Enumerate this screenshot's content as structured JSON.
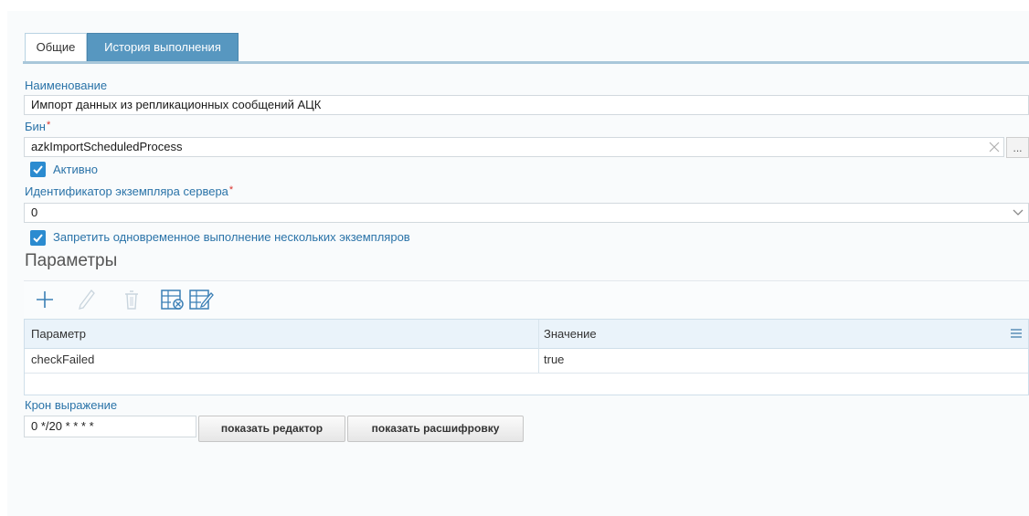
{
  "tabs": [
    {
      "label": "Общие",
      "active": true
    },
    {
      "label": "История выполнения",
      "active": false
    }
  ],
  "form": {
    "name_label": "Наименование",
    "name_value": "Импорт данных из репликационных сообщений АЦК",
    "bean_label": "Бин",
    "bean_value": "azkImportScheduledProcess",
    "bean_clear_icon": "close-icon",
    "bean_lookup_label": "...",
    "active_label": "Активно",
    "active_checked": true,
    "server_id_label": "Идентификатор экземпляра сервера",
    "server_id_value": "0",
    "concurrent_label": "Запретить одновременное выполнение нескольких экземпляров",
    "concurrent_checked": true,
    "required_mark": "*"
  },
  "params": {
    "title": "Параметры",
    "toolbar_icons": [
      "plus-icon",
      "pencil-icon",
      "trash-icon",
      "table-remove-icon",
      "table-edit-icon"
    ],
    "columns": [
      "Параметр",
      "Значение"
    ],
    "rows": [
      {
        "name": "checkFailed",
        "value": "true"
      }
    ]
  },
  "cron": {
    "label": "Крон выражение",
    "value": "0 */20 * * * *",
    "show_editor": "показать редактор",
    "show_decoding": "показать расшифровку"
  },
  "colors": {
    "accent": "#2b8bd0",
    "label": "#2a73a8",
    "tab_inactive": "#5797c0",
    "required": "#d9312b"
  }
}
